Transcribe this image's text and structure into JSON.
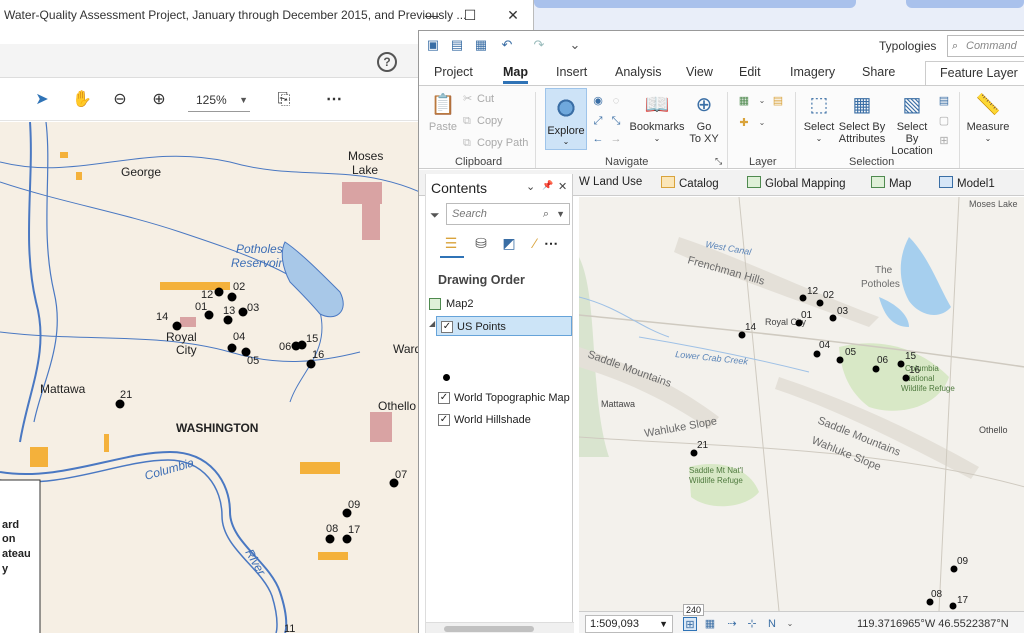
{
  "pdf_viewer": {
    "title": "Water-Quality Assessment Project, January through December 2015, and Previously ...",
    "window_controls": {
      "minimize": "—",
      "maximize": "☐",
      "close": "✕"
    },
    "help": "?",
    "zoom": "125%",
    "map": {
      "places": [
        {
          "name": "George"
        },
        {
          "name": "Moses"
        },
        {
          "name": "Lake"
        },
        {
          "name": "Potholes"
        },
        {
          "name": "Reservoir"
        },
        {
          "name": "Royal"
        },
        {
          "name": "City"
        },
        {
          "name": "Mattawa"
        },
        {
          "name": "WASHINGTON"
        },
        {
          "name": "Othello"
        },
        {
          "name": "Ward"
        },
        {
          "name": "Columbia"
        },
        {
          "name": "River"
        }
      ],
      "points": [
        "01",
        "02",
        "03",
        "04",
        "05",
        "06",
        "12",
        "13",
        "14",
        "15",
        "16",
        "21",
        "07",
        "09",
        "08",
        "17",
        "11"
      ],
      "legend_fragments": [
        "ard",
        "on",
        "ateau",
        "y"
      ]
    }
  },
  "arcgis": {
    "quick_access": {
      "typologies": "Typologies",
      "command_search_placeholder": "Command Search"
    },
    "ribbon_tabs": [
      "Project",
      "Map",
      "Insert",
      "Analysis",
      "View",
      "Edit",
      "Imagery",
      "Share"
    ],
    "active_tab": "Map",
    "contextual_tab": "Feature Layer",
    "clipboard": {
      "paste": "Paste",
      "cut": "Cut",
      "copy": "Copy",
      "copy_path": "Copy Path",
      "label": "Clipboard"
    },
    "navigate": {
      "explore": "Explore",
      "bookmarks": "Bookmarks",
      "go_to_xy": "Go",
      "go_to_xy_2": "To XY",
      "label": "Navigate"
    },
    "layer": {
      "label": "Layer"
    },
    "selection": {
      "select": "Select",
      "select_by_attributes": "Select By",
      "select_by_attributes_2": "Attributes",
      "select_by_location": "Select By",
      "select_by_location_2": "Location",
      "label": "Selection"
    },
    "inquiry": {
      "measure": "Measure"
    },
    "view_tabs": [
      "W Land Use",
      "Catalog",
      "Global Mapping",
      "Map",
      "Model1"
    ],
    "contents": {
      "title": "Contents",
      "controls": {
        "dropdown": "⌄",
        "pin": "📌",
        "close": "✕"
      },
      "search_placeholder": "Search",
      "drawing_order": "Drawing Order",
      "map_name": "Map2",
      "layers": [
        {
          "name": "US Points",
          "checked": true,
          "selected": true
        },
        {
          "name": "World Topographic Map",
          "checked": true
        },
        {
          "name": "World Hillshade",
          "checked": true
        }
      ]
    },
    "map": {
      "places": [
        {
          "name": "Moses Lake"
        },
        {
          "name": "West Canal"
        },
        {
          "name": "Frenchman Hills"
        },
        {
          "name": "The"
        },
        {
          "name": "Potholes"
        },
        {
          "name": "Royal City"
        },
        {
          "name": "Lower Crab Creek"
        },
        {
          "name": "Saddle Mountains"
        },
        {
          "name": "Mattawa"
        },
        {
          "name": "Wahluke Slope"
        },
        {
          "name": "Saddle Mountains"
        },
        {
          "name": "Wahluke Slope"
        },
        {
          "name": "Columbia"
        },
        {
          "name": "National"
        },
        {
          "name": "Wildlife Refuge"
        },
        {
          "name": "Othello"
        },
        {
          "name": "Saddle Mt Nat'l"
        },
        {
          "name": "Wildlife Refuge"
        }
      ],
      "points": [
        "12",
        "02",
        "01",
        "03",
        "14",
        "04",
        "05",
        "06",
        "15",
        "16",
        "21",
        "09",
        "08",
        "17"
      ]
    },
    "status": {
      "scale": "1:509,093",
      "dpi": "240",
      "coordinates": "119.3716965°W 46.5522387°N"
    }
  },
  "colors": {
    "accent": "#2f73b6",
    "selection": "#cce4f7"
  }
}
